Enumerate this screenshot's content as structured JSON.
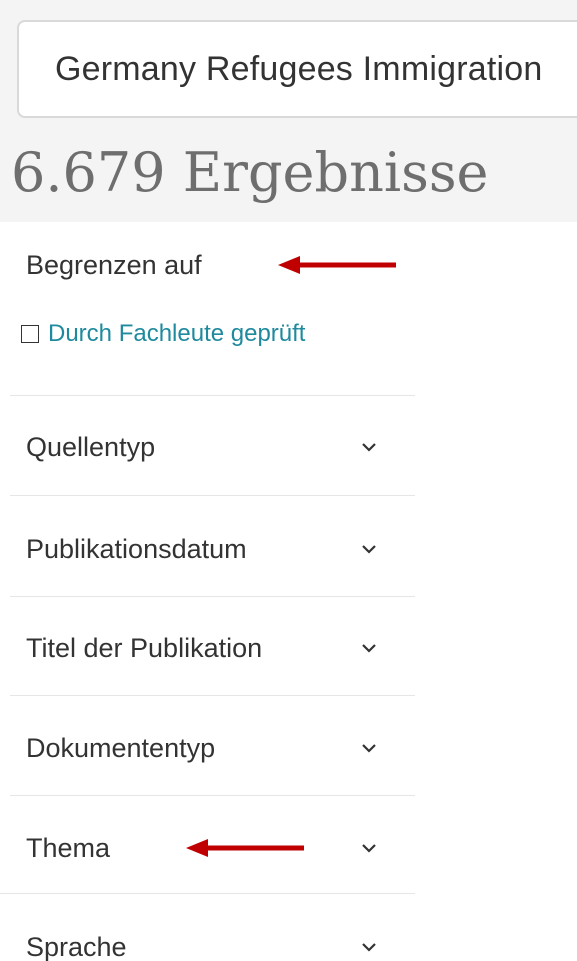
{
  "search": {
    "query": "Germany Refugees Immigration"
  },
  "results": {
    "count_text": "6.679 Ergebnisse"
  },
  "sidebar": {
    "limit_title": "Begrenzen auf",
    "peer_review_label": "Durch Fachleute geprüft",
    "facets": [
      {
        "label": "Quellentyp",
        "icon": "chevron-down-icon"
      },
      {
        "label": "Publikationsdatum",
        "icon": "chevron-down-icon"
      },
      {
        "label": "Titel der Publikation",
        "icon": "chevron-down-icon"
      },
      {
        "label": "Dokumententyp",
        "icon": "chevron-down-icon"
      },
      {
        "label": "Thema",
        "icon": "chevron-down-icon"
      },
      {
        "label": "Sprache",
        "icon": "chevron-down-icon"
      }
    ]
  },
  "annotations": {
    "arrow_color": "#c00000",
    "link_color": "#1f8a9e"
  }
}
